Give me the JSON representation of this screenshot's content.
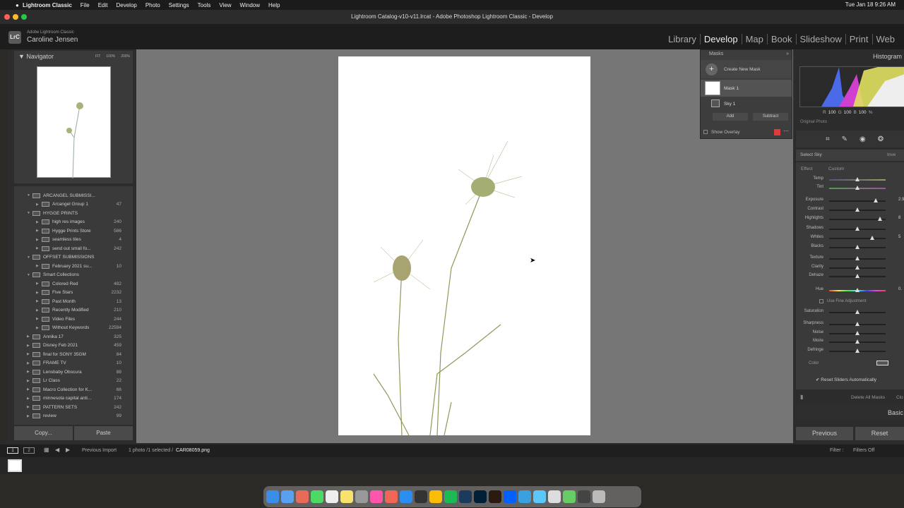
{
  "menubar": {
    "app": "Lightroom Classic",
    "items": [
      "File",
      "Edit",
      "Develop",
      "Photo",
      "Settings",
      "Tools",
      "View",
      "Window",
      "Help"
    ],
    "clock": "Tue Jan 18  9:26 AM"
  },
  "window": {
    "title": "Lightroom Catalog-v10-v11.lrcat - Adobe Photoshop Lightroom Classic - Develop"
  },
  "identity": {
    "logo": "LrC",
    "product": "Adobe Lightroom Classic",
    "user": "Caroline Jensen"
  },
  "modules": [
    "Library",
    "Develop",
    "Map",
    "Book",
    "Slideshow",
    "Print",
    "Web"
  ],
  "navigator": {
    "title": "Navigator",
    "zoom": [
      "FIT",
      "100%",
      "200%"
    ]
  },
  "collections": [
    {
      "label": "ARCANGEL SUBMISSI...",
      "count": "",
      "level": 0,
      "open": true,
      "set": true
    },
    {
      "label": "Arcangel Group 1",
      "count": "47",
      "level": 1
    },
    {
      "label": "HYGGE PRINTS",
      "count": "",
      "level": 0,
      "open": true,
      "set": true
    },
    {
      "label": "high res images",
      "count": "240",
      "level": 1
    },
    {
      "label": "Hygge Prints Store",
      "count": "586",
      "level": 1
    },
    {
      "label": "seamless tiles",
      "count": "4",
      "level": 1
    },
    {
      "label": "send out small fo...",
      "count": "242",
      "level": 1
    },
    {
      "label": "OFFSET SUBMISSIONS",
      "count": "",
      "level": 0,
      "open": true,
      "set": true
    },
    {
      "label": "February 2021 su...",
      "count": "10",
      "level": 1
    },
    {
      "label": "Smart Collections",
      "count": "",
      "level": 0,
      "open": true,
      "set": true
    },
    {
      "label": "Colored Red",
      "count": "482",
      "level": 1
    },
    {
      "label": "Five Stars",
      "count": "2232",
      "level": 1
    },
    {
      "label": "Past Month",
      "count": "13",
      "level": 1
    },
    {
      "label": "Recently Modified",
      "count": "210",
      "level": 1
    },
    {
      "label": "Video Files",
      "count": "244",
      "level": 1
    },
    {
      "label": "Without Keywords",
      "count": "22594",
      "level": 1
    },
    {
      "label": "Annika 17",
      "count": "325",
      "level": 0
    },
    {
      "label": "Disney Feb 2021",
      "count": "459",
      "level": 0
    },
    {
      "label": "final for SONY 35GM",
      "count": "84",
      "level": 0
    },
    {
      "label": "FRAME TV",
      "count": "10",
      "level": 0
    },
    {
      "label": "Lensbaby Obscura",
      "count": "88",
      "level": 0
    },
    {
      "label": "Lr Class",
      "count": "22",
      "level": 0
    },
    {
      "label": "Macro Collection for K...",
      "count": "66",
      "level": 0
    },
    {
      "label": "minnesota capital anti...",
      "count": "174",
      "level": 0
    },
    {
      "label": "PATTERN SETS",
      "count": "242",
      "level": 0
    },
    {
      "label": "review",
      "count": "99",
      "level": 0
    }
  ],
  "left_buttons": {
    "copy": "Copy...",
    "paste": "Paste"
  },
  "masks": {
    "title": "Masks",
    "create": "Create New Mask",
    "mask1": "Mask 1",
    "sky1": "Sky 1",
    "add": "Add",
    "subtract": "Subtract",
    "overlay": "Show Overlay",
    "overlay_color": "#e03a3a"
  },
  "histogram": {
    "title": "Histogram",
    "r_label": "R",
    "r": "100",
    "g_label": "G",
    "g": "100",
    "b_label": "B",
    "b": "100",
    "pct": "%",
    "original": "Original Photo"
  },
  "mask_panel": {
    "select": "Select Sky",
    "invert": "Inve",
    "effect_label": "Effect",
    "effect": "Custom",
    "sliders": [
      {
        "label": "Temp",
        "pos": 0.5,
        "value": ""
      },
      {
        "label": "Tint",
        "pos": 0.5,
        "value": ""
      },
      {
        "label": "Exposure",
        "pos": 0.83,
        "value": "2.9"
      },
      {
        "label": "Contrast",
        "pos": 0.5,
        "value": ""
      },
      {
        "label": "Highlights",
        "pos": 0.9,
        "value": "8"
      },
      {
        "label": "Shadows",
        "pos": 0.5,
        "value": ""
      },
      {
        "label": "Whites",
        "pos": 0.76,
        "value": "5"
      },
      {
        "label": "Blacks",
        "pos": 0.5,
        "value": ""
      },
      {
        "label": "Texture",
        "pos": 0.5,
        "value": ""
      },
      {
        "label": "Clarity",
        "pos": 0.5,
        "value": ""
      },
      {
        "label": "Dehaze",
        "pos": 0.5,
        "value": ""
      },
      {
        "label": "Hue",
        "pos": 0.5,
        "value": "0."
      },
      {
        "label": "Saturation",
        "pos": 0.5,
        "value": ""
      },
      {
        "label": "Sharpness",
        "pos": 0.5,
        "value": ""
      },
      {
        "label": "Noise",
        "pos": 0.5,
        "value": ""
      },
      {
        "label": "Moire",
        "pos": 0.5,
        "value": ""
      },
      {
        "label": "Defringe",
        "pos": 0.5,
        "value": ""
      }
    ],
    "fine": "Use Fine Adjustment",
    "color": "Color",
    "reset": "Reset Sliders Automatically",
    "delete_all": "Delete All Masks",
    "close": "Clo",
    "basic": "Basic"
  },
  "right_buttons": {
    "previous": "Previous",
    "reset": "Reset"
  },
  "filmstrip": {
    "view1": "1",
    "view2": "2",
    "source": "Previous Import",
    "info": "1 photo /1 selected /",
    "file": "CAR08059.png",
    "filter": "Filter :",
    "filters_off": "Filters Off"
  }
}
